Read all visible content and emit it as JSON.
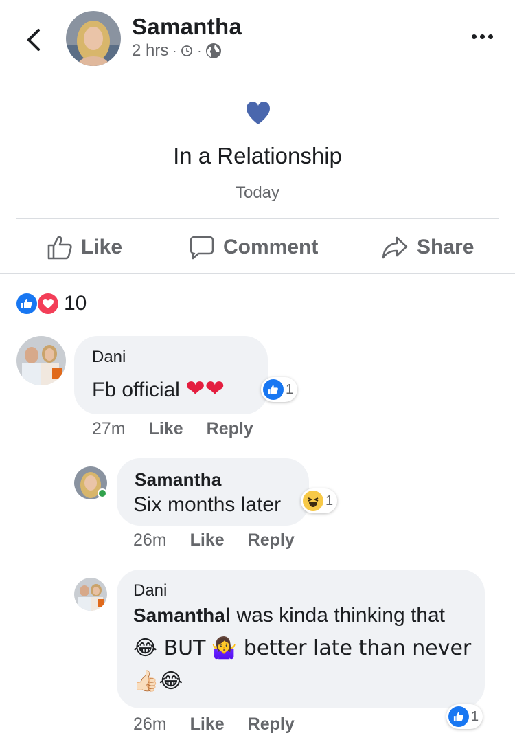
{
  "header": {
    "poster_name": "Samantha",
    "time": "2 hrs",
    "meta_sep": "·",
    "icons": [
      "back-chevron-icon",
      "clock-icon",
      "globe-icon",
      "more-icon"
    ]
  },
  "life_event": {
    "icon": "heart-icon",
    "title": "In a Relationship",
    "date": "Today"
  },
  "actions": {
    "like": "Like",
    "comment": "Comment",
    "share": "Share"
  },
  "reactions": {
    "types": [
      "like",
      "love"
    ],
    "count": "10"
  },
  "comments": [
    {
      "author": "Dani",
      "text": "Fb official",
      "emoji": "❤❤",
      "reaction_count": "1",
      "time": "27m",
      "like_label": "Like",
      "reply_label": "Reply"
    },
    {
      "author": "Samantha",
      "text": "Six months later",
      "reaction_count": "1",
      "time": "26m",
      "like_label": "Like",
      "reply_label": "Reply"
    },
    {
      "author": "Dani",
      "mention": "Samantha",
      "text_line1": "I was kinda thinking that",
      "text_line2a": "😂 BUT",
      "text_line2b": "🤷‍♀️ better late than never",
      "text_line3": "👍🏻😂",
      "reaction_count": "1",
      "time": "26m",
      "like_label": "Like",
      "reply_label": "Reply"
    }
  ],
  "colors": {
    "accent": "#1877f2",
    "heart": "#4a67ad",
    "love": "#f33e58",
    "muted": "#65676b",
    "bubble": "#f0f2f5",
    "online": "#31a24c"
  }
}
